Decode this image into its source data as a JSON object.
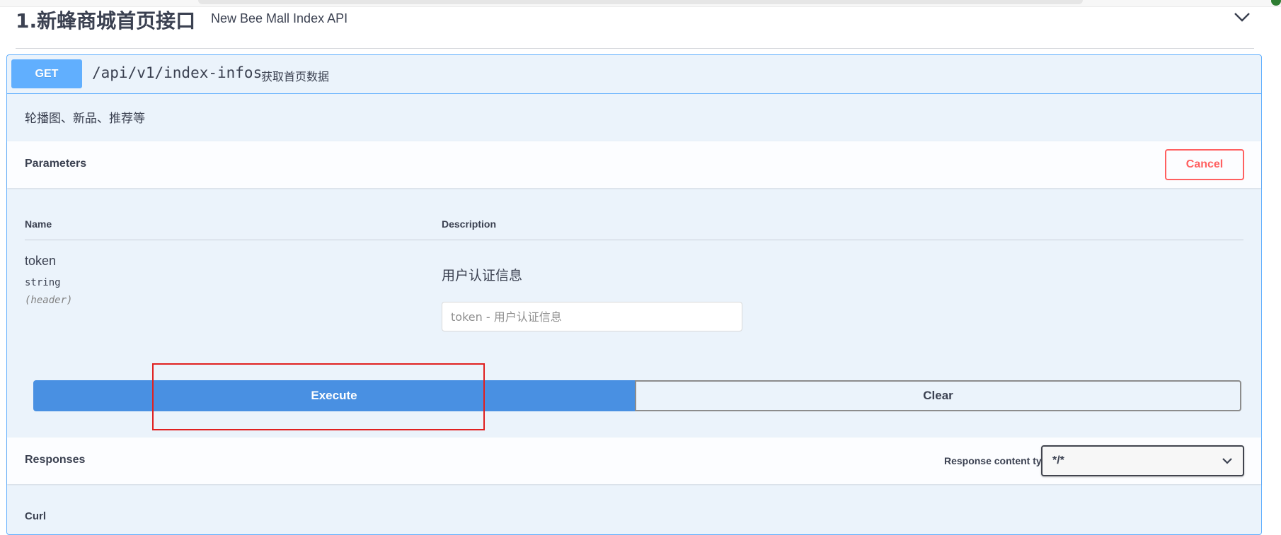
{
  "tag": {
    "title": "1.新蜂商城首页接口",
    "description": "New Bee Mall Index API"
  },
  "operation": {
    "method": "GET",
    "path": "/api/v1/index-infos",
    "summary": "获取首页数据",
    "description": "轮播图、新品、推荐等"
  },
  "parameters": {
    "title": "Parameters",
    "cancel_label": "Cancel",
    "col_name": "Name",
    "col_description": "Description",
    "items": [
      {
        "name": "token",
        "type": "string",
        "in": "(header)",
        "description": "用户认证信息",
        "placeholder": "token - 用户认证信息"
      }
    ]
  },
  "actions": {
    "execute_label": "Execute",
    "clear_label": "Clear"
  },
  "responses": {
    "title": "Responses",
    "content_type_label": "Response content type",
    "content_type_value": "*/*"
  },
  "curl": {
    "label": "Curl"
  },
  "colors": {
    "get_accent": "#61affe",
    "execute": "#4990e2",
    "cancel": "#ff6060",
    "highlight": "#e02020"
  },
  "icons": {
    "collapse": "chevron-down-icon",
    "select": "chevron-down-icon"
  }
}
